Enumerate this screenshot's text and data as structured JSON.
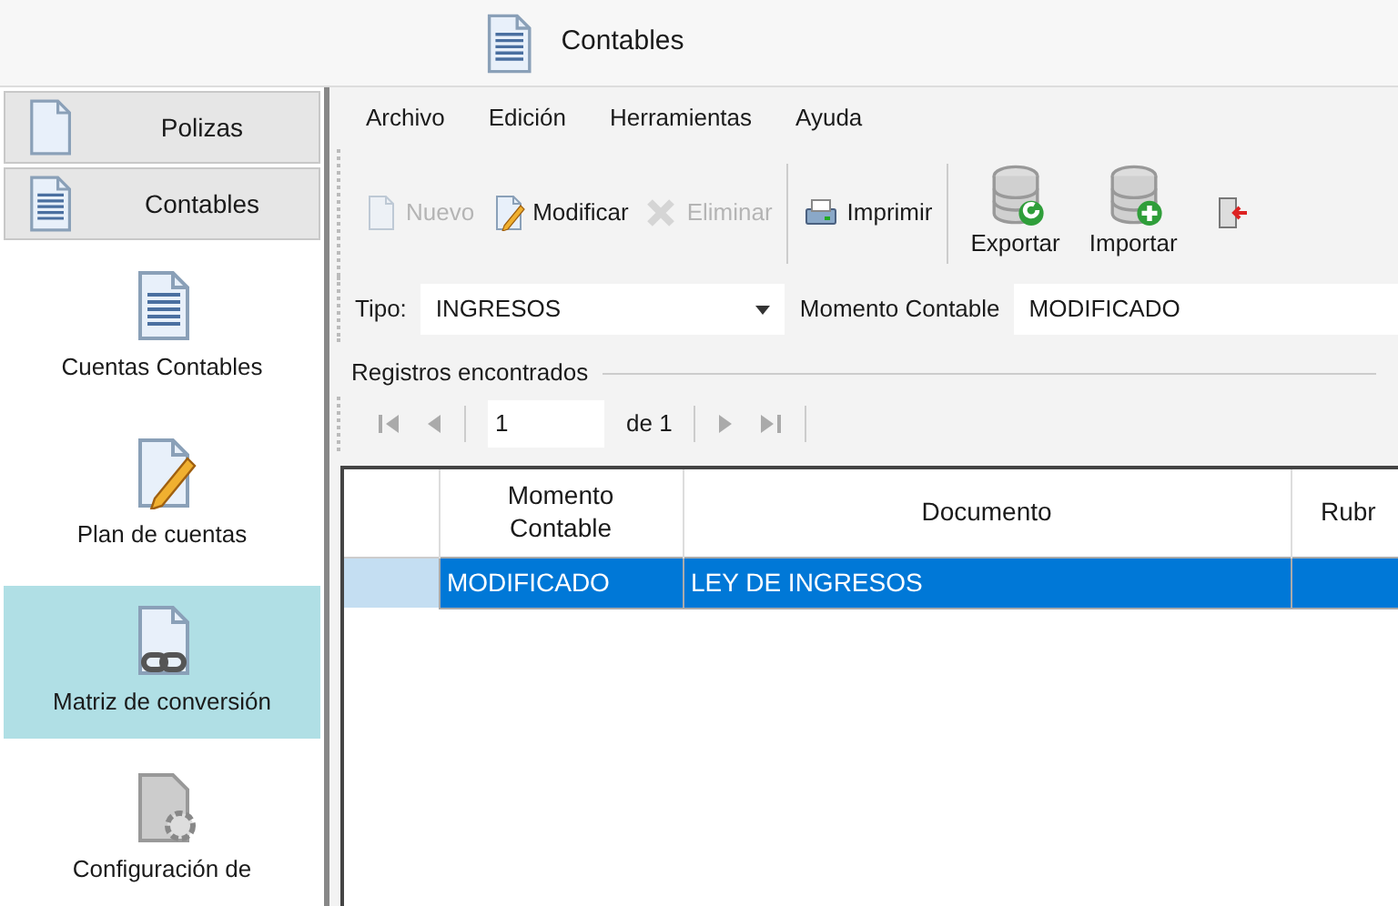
{
  "window": {
    "title": "Contables"
  },
  "sidebar": {
    "groups": [
      {
        "label": "Polizas"
      },
      {
        "label": "Contables"
      }
    ],
    "items": [
      {
        "label": "Cuentas Contables",
        "selected": false
      },
      {
        "label": "Plan de cuentas",
        "selected": false
      },
      {
        "label": "Matriz de conversión",
        "selected": true
      },
      {
        "label": "Configuración de",
        "selected": false
      }
    ]
  },
  "menu": [
    "Archivo",
    "Edición",
    "Herramientas",
    "Ayuda"
  ],
  "toolbar": [
    {
      "kind": "small",
      "label": "Nuevo",
      "disabled": true
    },
    {
      "kind": "small",
      "label": "Modificar",
      "disabled": false
    },
    {
      "kind": "small",
      "label": "Eliminar",
      "disabled": true
    },
    {
      "kind": "separator"
    },
    {
      "kind": "small",
      "label": "Imprimir",
      "disabled": false
    },
    {
      "kind": "separator"
    },
    {
      "kind": "large",
      "label": "Exportar",
      "disabled": false
    },
    {
      "kind": "large",
      "label": "Importar",
      "disabled": false
    },
    {
      "kind": "icon"
    }
  ],
  "filters": {
    "tipo_label": "Tipo:",
    "tipo_value": "INGRESOS",
    "momento_label": "Momento Contable",
    "momento_value": "MODIFICADO"
  },
  "group_title": "Registros encontrados",
  "pager": {
    "page": "1",
    "of": "de 1"
  },
  "table": {
    "columns": [
      "",
      "Momento\nContable",
      "Documento",
      "Rubr"
    ],
    "rows": [
      {
        "cells": [
          "",
          "MODIFICADO",
          "LEY DE INGRESOS",
          ""
        ],
        "selected": true
      }
    ]
  }
}
